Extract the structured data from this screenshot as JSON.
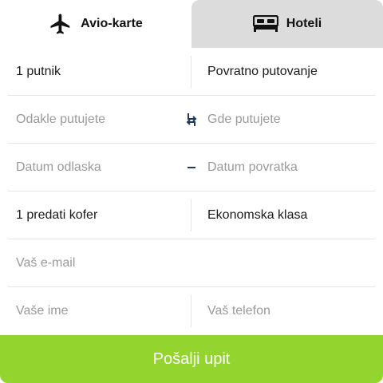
{
  "tabs": {
    "flights": {
      "label": "Avio-karte",
      "icon": "airplane-icon"
    },
    "hotels": {
      "label": "Hoteli",
      "icon": "bed-icon"
    }
  },
  "form": {
    "passengers": "1 putnik",
    "trip_type": "Povratno putovanje",
    "from_placeholder": "Odakle putujete",
    "to_placeholder": "Gde putujete",
    "departure_placeholder": "Datum odlaska",
    "return_placeholder": "Datum povratka",
    "baggage": "1 predati kofer",
    "class": "Ekonomska klasa",
    "email_placeholder": "Vaš e-mail",
    "name_placeholder": "Vaše ime",
    "phone_placeholder": "Vaš telefon"
  },
  "submit_label": "Pošalji upit",
  "colors": {
    "accent": "#93d42e",
    "inactive_tab": "#dcdcdc",
    "icon_blue": "#1f3a5f"
  }
}
